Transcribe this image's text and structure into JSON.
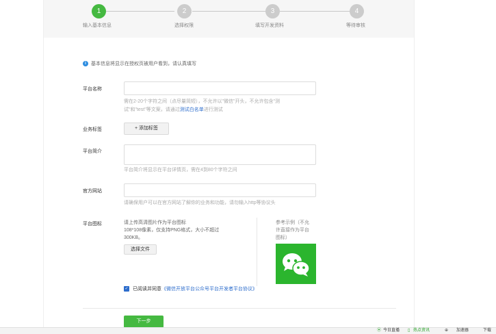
{
  "steps": [
    {
      "number": "1",
      "label": "输入基本信息",
      "active": true
    },
    {
      "number": "2",
      "label": "选择权限",
      "active": false
    },
    {
      "number": "3",
      "label": "填写开发资料",
      "active": false
    },
    {
      "number": "4",
      "label": "等待审核",
      "active": false
    }
  ],
  "notice": "基本信息将显示在授权页被用户看到，请认真填写",
  "form": {
    "name_label": "平台名称",
    "name_hint_1": "需在2-20个字符之间（点尽量简短），不允许以\"微信\"开头，不允许包含\"测",
    "name_hint_2_a": "试\"和\"test\"等文案，请通过",
    "name_hint_2_link": "测试白名单",
    "name_hint_2_b": "进行测试",
    "tag_label": "业务标签",
    "tag_button": "+ 添加标签",
    "intro_label": "平台简介",
    "intro_hint": "平台简介将显示在平台详情页，需在4到80个字符之间",
    "site_label": "官方网站",
    "site_hint": "请确保用户可以在官方网站了解你的业务和功能，请勿输入http等协议头",
    "icon_label": "平台图标",
    "icon_text_1": "请上传高清图片作为平台图标",
    "icon_text_2": "108*108像素，仅支持PNG格式，大小不超过",
    "icon_text_3": "300KB。",
    "choose_file": "选择文件",
    "ref_text_1": "参考示例（不允",
    "ref_text_2": "许直接作为平台",
    "ref_text_3": "图标）",
    "agree_text": "已阅读并同意",
    "agree_link": "《微信开放平台公众号平台开发者平台协议》",
    "next_button": "下一步"
  },
  "taskbar": {
    "item1": "今日直播",
    "item2": "热点资讯",
    "item3": "⊕",
    "item4": "加速器",
    "item5": "下载"
  },
  "colors": {
    "accent_green": "#45b941",
    "link_blue": "#2d6dcc",
    "info_blue": "#2d8de0"
  }
}
